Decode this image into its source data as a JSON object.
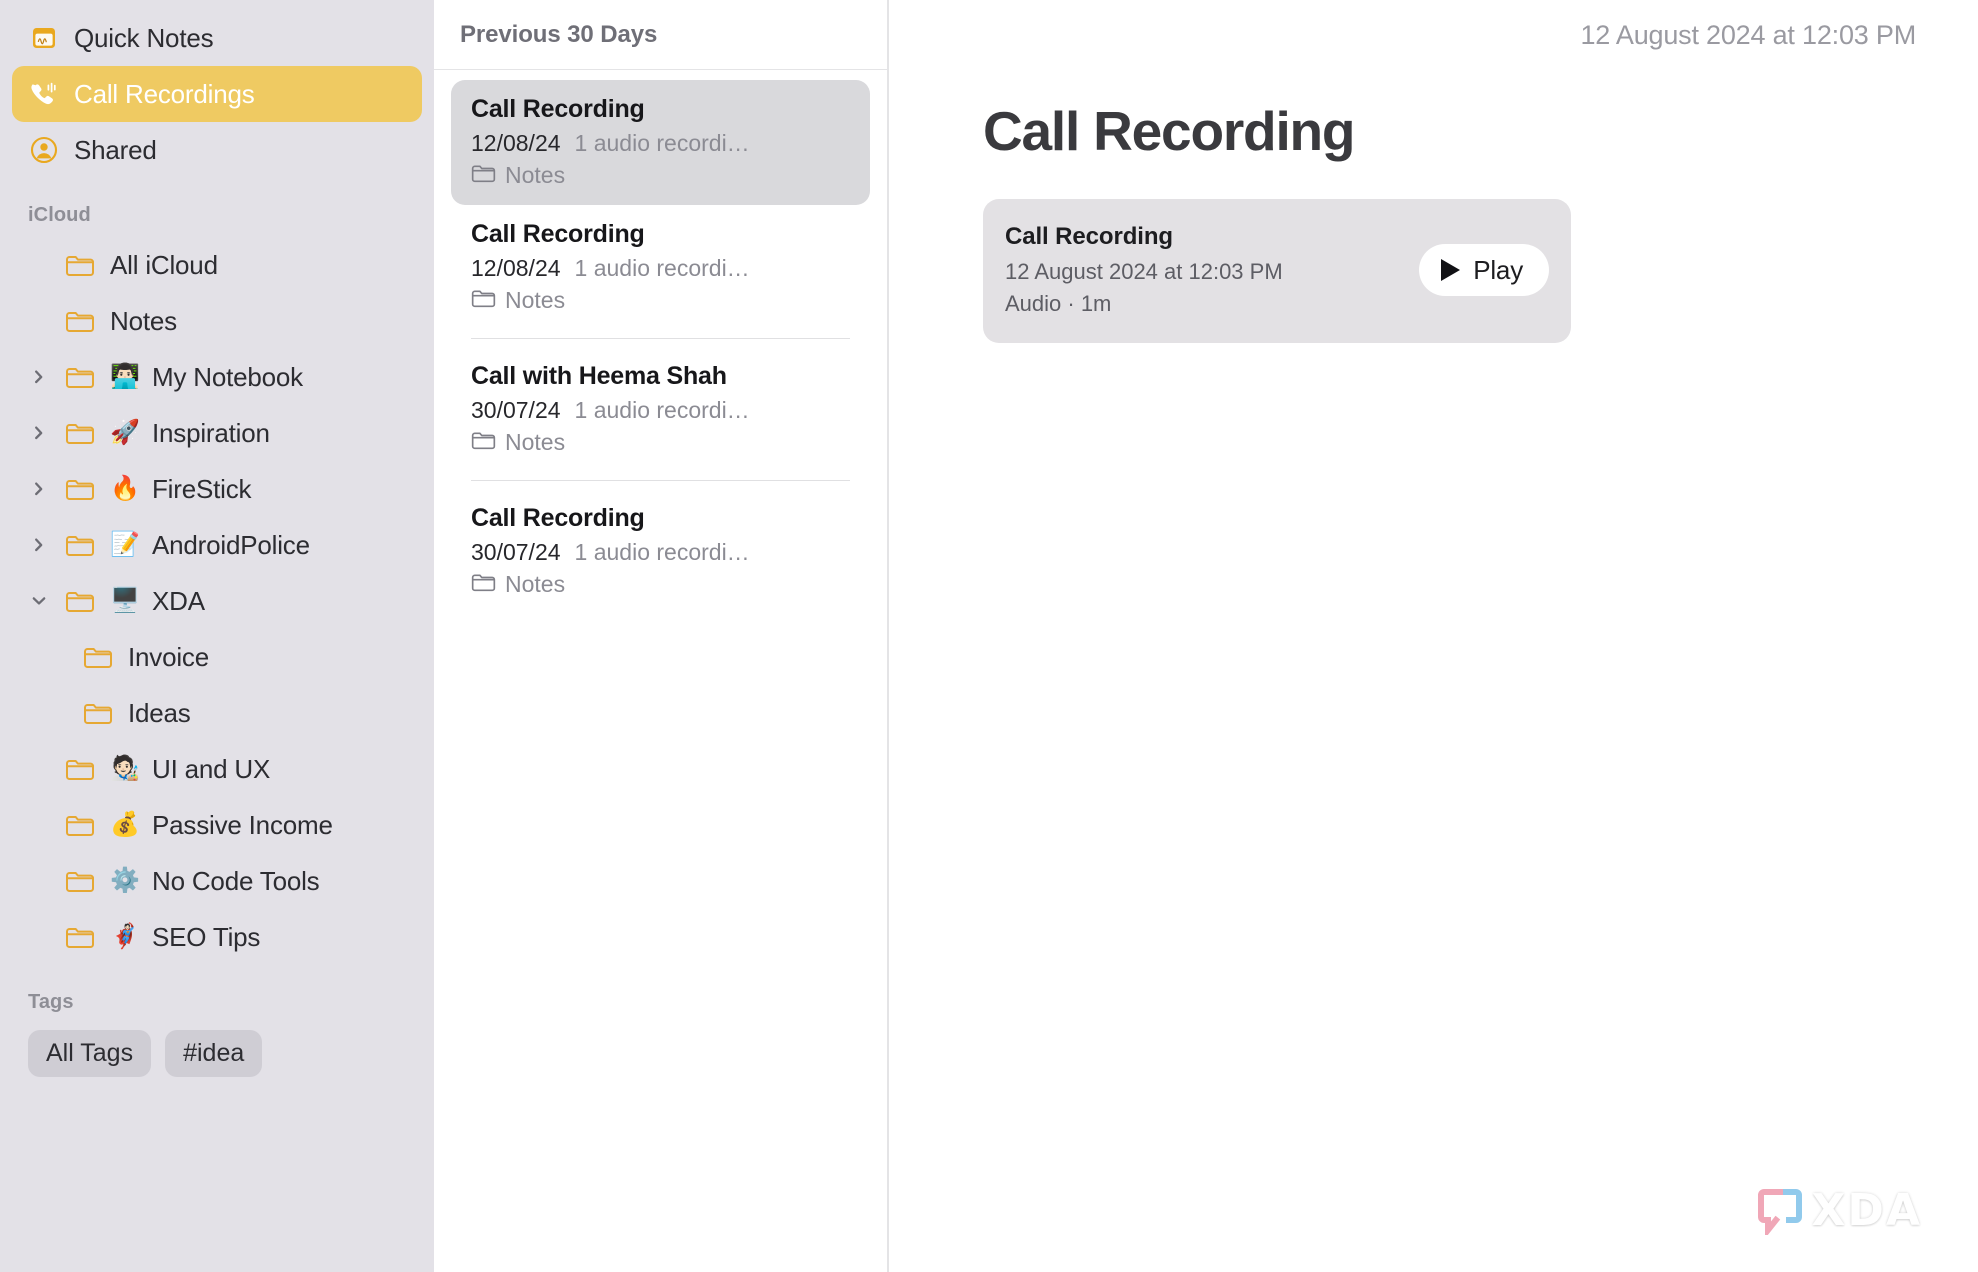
{
  "sidebar": {
    "top_items": [
      {
        "label": "Quick Notes",
        "icon": "quick-notes-icon",
        "selected": false
      },
      {
        "label": "Call Recordings",
        "icon": "phone-waves-icon",
        "selected": true
      },
      {
        "label": "Shared",
        "icon": "person-circle-icon",
        "selected": false
      }
    ],
    "icloud_section_label": "iCloud",
    "icloud_items": [
      {
        "label": "All iCloud",
        "emoji": "",
        "disclosure": "none",
        "indent": 0
      },
      {
        "label": "Notes",
        "emoji": "",
        "disclosure": "none",
        "indent": 0
      },
      {
        "label": "My Notebook",
        "emoji": "👨🏻‍💻",
        "disclosure": "collapsed",
        "indent": 0
      },
      {
        "label": "Inspiration",
        "emoji": "🚀",
        "disclosure": "collapsed",
        "indent": 0
      },
      {
        "label": "FireStick",
        "emoji": "🔥",
        "disclosure": "collapsed",
        "indent": 0
      },
      {
        "label": "AndroidPolice",
        "emoji": "📝",
        "disclosure": "collapsed",
        "indent": 0
      },
      {
        "label": "XDA",
        "emoji": "🖥️",
        "disclosure": "expanded",
        "indent": 0
      },
      {
        "label": "Invoice",
        "emoji": "",
        "disclosure": "none",
        "indent": 1
      },
      {
        "label": "Ideas",
        "emoji": "",
        "disclosure": "none",
        "indent": 1
      },
      {
        "label": "UI and UX",
        "emoji": "🧑🏻‍🎨",
        "disclosure": "none",
        "indent": 0
      },
      {
        "label": "Passive Income",
        "emoji": "💰",
        "disclosure": "none",
        "indent": 0
      },
      {
        "label": "No Code Tools",
        "emoji": "⚙️",
        "disclosure": "none",
        "indent": 0
      },
      {
        "label": "SEO Tips",
        "emoji": "🦸🏻",
        "disclosure": "none",
        "indent": 0
      }
    ],
    "tags_section_label": "Tags",
    "tags": [
      {
        "label": "All Tags"
      },
      {
        "label": "#idea"
      }
    ]
  },
  "list": {
    "header": "Previous 30 Days",
    "items": [
      {
        "title": "Call Recording",
        "date": "12/08/24",
        "subtitle": "1 audio recordi…",
        "folder": "Notes",
        "selected": true
      },
      {
        "title": "Call Recording",
        "date": "12/08/24",
        "subtitle": "1 audio recordi…",
        "folder": "Notes",
        "selected": false
      },
      {
        "title": "Call with Heema Shah",
        "date": "30/07/24",
        "subtitle": "1 audio recordi…",
        "folder": "Notes",
        "selected": false
      },
      {
        "title": "Call Recording",
        "date": "30/07/24",
        "subtitle": "1 audio recordi…",
        "folder": "Notes",
        "selected": false
      }
    ]
  },
  "main": {
    "timestamp": "12 August 2024 at 12:03 PM",
    "title": "Call Recording",
    "audio_card": {
      "title": "Call Recording",
      "date": "12 August 2024 at 12:03 PM",
      "meta": "Audio · 1m",
      "play_label": "Play"
    }
  },
  "watermark": {
    "text": "XDA"
  },
  "colors": {
    "sidebar_bg": "#E3E1E7",
    "selected_accent": "#EFCA62",
    "folder_icon": "#E6A833",
    "list_selected_bg": "#D9D9DC",
    "card_bg": "#E3E1E4",
    "muted_text": "#8B8B93"
  }
}
